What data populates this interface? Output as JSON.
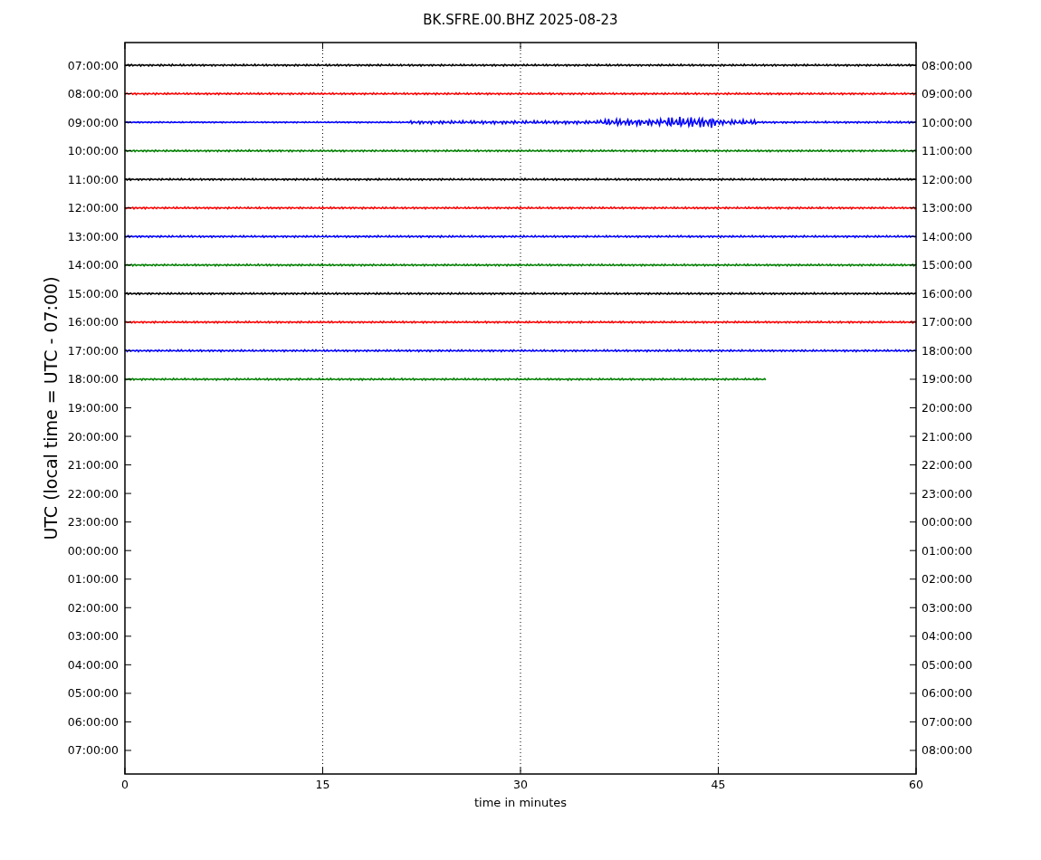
{
  "title": "BK.SFRE.00.BHZ 2025-08-23",
  "ylabel": "UTC (local time = UTC - 07:00)",
  "xlabel": "time in minutes",
  "xticks": [
    "0",
    "15",
    "30",
    "45",
    "60"
  ],
  "left_labels": [
    "07:00:00",
    "08:00:00",
    "09:00:00",
    "10:00:00",
    "11:00:00",
    "12:00:00",
    "13:00:00",
    "14:00:00",
    "15:00:00",
    "16:00:00",
    "17:00:00",
    "18:00:00",
    "19:00:00",
    "20:00:00",
    "21:00:00",
    "22:00:00",
    "23:00:00",
    "00:00:00",
    "01:00:00",
    "02:00:00",
    "03:00:00",
    "04:00:00",
    "05:00:00",
    "06:00:00",
    "07:00:00"
  ],
  "right_labels": [
    "08:00:00",
    "09:00:00",
    "10:00:00",
    "11:00:00",
    "12:00:00",
    "13:00:00",
    "14:00:00",
    "15:00:00",
    "16:00:00",
    "17:00:00",
    "18:00:00",
    "19:00:00",
    "20:00:00",
    "21:00:00",
    "22:00:00",
    "23:00:00",
    "00:00:00",
    "01:00:00",
    "02:00:00",
    "03:00:00",
    "04:00:00",
    "05:00:00",
    "06:00:00",
    "07:00:00",
    "08:00:00"
  ],
  "traces": [
    {
      "kind": "quiet",
      "color": "#000000",
      "level": 1
    },
    {
      "kind": "quiet",
      "color": "#ff0000",
      "level": 1
    },
    {
      "kind": "event",
      "color": "#0000ff",
      "level": 1
    },
    {
      "kind": "quiet",
      "color": "#008000",
      "level": 1
    },
    {
      "kind": "quiet",
      "color": "#000000",
      "level": 1
    },
    {
      "kind": "quiet",
      "color": "#ff0000",
      "level": 1
    },
    {
      "kind": "quiet",
      "color": "#0000ff",
      "level": 1
    },
    {
      "kind": "quiet",
      "color": "#008000",
      "level": 1
    },
    {
      "kind": "quiet",
      "color": "#000000",
      "level": 1
    },
    {
      "kind": "quiet",
      "color": "#ff0000",
      "level": 1
    },
    {
      "kind": "quiet",
      "color": "#0000ff",
      "level": 1
    },
    {
      "kind": "quiet",
      "color": "#008000",
      "level": 0.81
    }
  ]
}
